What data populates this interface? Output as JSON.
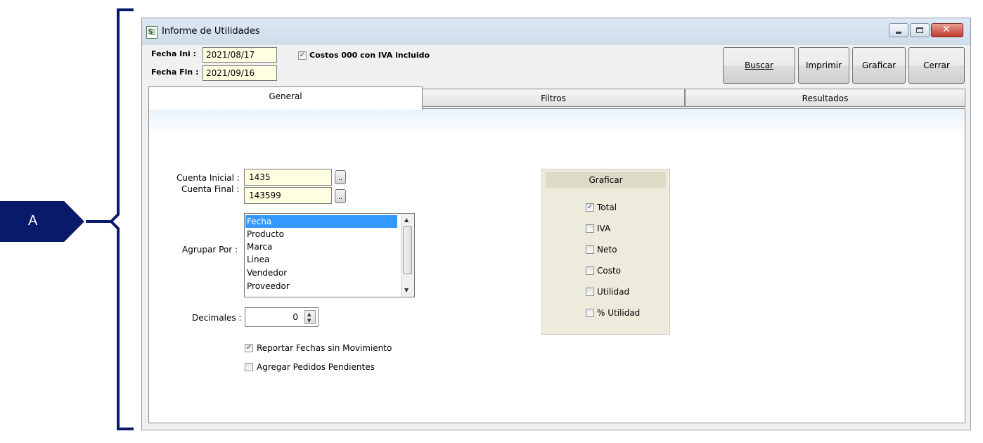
{
  "annotation": {
    "label": "A"
  },
  "window": {
    "title": "Informe de Utilidades",
    "controls": {
      "minimize_icon": "minimize-icon",
      "maximize_icon": "maximize-icon",
      "close_icon": "close-icon"
    }
  },
  "header": {
    "fecha_ini_label": "Fecha Ini :",
    "fecha_ini_value": "2021/08/17",
    "fecha_fin_label": "Fecha Fin :",
    "fecha_fin_value": "2021/09/16",
    "costos_label": "Costos 000 con IVA incluido",
    "costos_checked": true
  },
  "buttons": {
    "buscar": "Buscar",
    "imprimir": "Imprimir",
    "graficar": "Graficar",
    "cerrar": "Cerrar"
  },
  "tabs": [
    {
      "label": "General",
      "active": true
    },
    {
      "label": "Filtros",
      "active": false
    },
    {
      "label": "Resultados",
      "active": false
    }
  ],
  "general": {
    "cuenta_inicial_label": "Cuenta Inicial :",
    "cuenta_inicial_value": "1435",
    "cuenta_final_label": "Cuenta Final :",
    "cuenta_final_value": "143599",
    "browse_label": "..",
    "agrupar_label": "Agrupar Por :",
    "agrupar_items": [
      "Fecha",
      "Producto",
      "Marca",
      "Linea",
      "Vendedor",
      "Proveedor"
    ],
    "agrupar_selected": "Fecha",
    "decimales_label": "Decimales :",
    "decimales_value": "0",
    "reportar_label": "Reportar Fechas sin Movimiento",
    "reportar_checked": true,
    "pedidos_label": "Agregar Pedidos Pendientes",
    "pedidos_checked": false
  },
  "graficar_group": {
    "title": "Graficar",
    "options": [
      {
        "label": "Total",
        "checked": true
      },
      {
        "label": "IVA",
        "checked": false
      },
      {
        "label": "Neto",
        "checked": false
      },
      {
        "label": "Costo",
        "checked": false
      },
      {
        "label": "Utilidad",
        "checked": false
      },
      {
        "label": "% Utilidad",
        "checked": false
      }
    ]
  },
  "colors": {
    "annotation": "#0a1a6b",
    "field_bg": "#ffffe1",
    "selection": "#3399ff",
    "group_bg": "#ecebdc"
  }
}
